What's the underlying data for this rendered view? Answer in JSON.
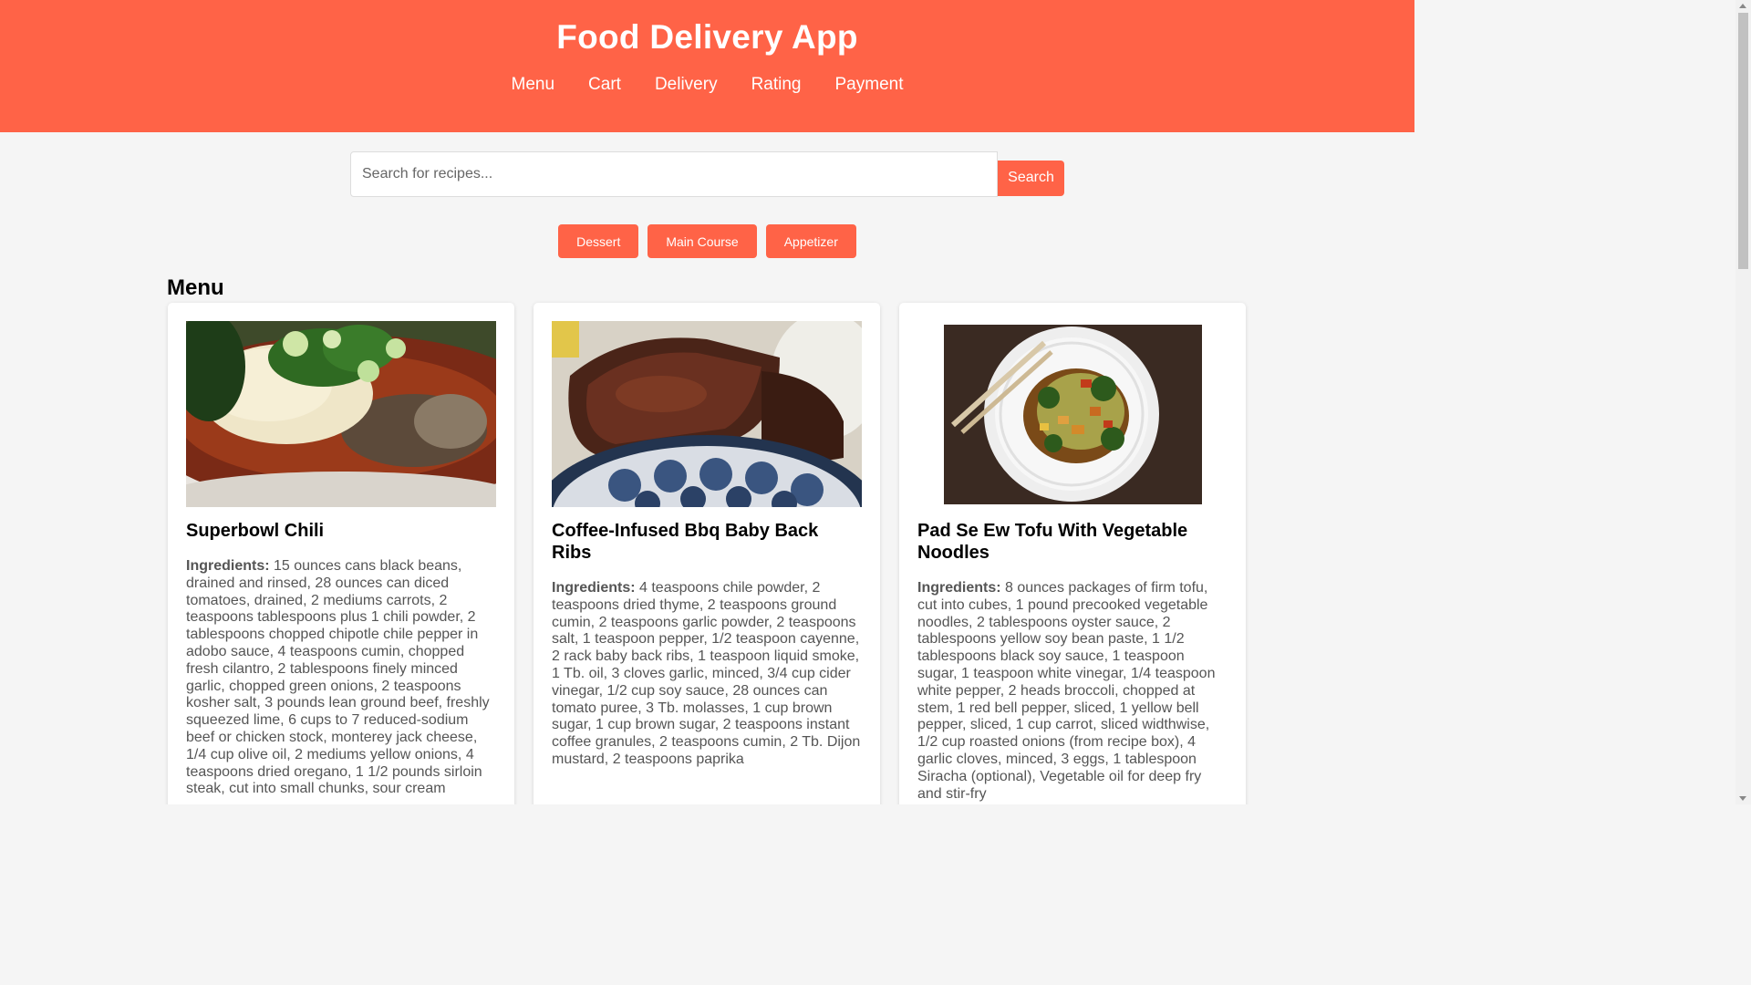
{
  "header": {
    "title": "Food Delivery App",
    "nav": [
      "Menu",
      "Cart",
      "Delivery",
      "Rating",
      "Payment"
    ]
  },
  "search": {
    "placeholder": "Search for recipes...",
    "button_label": "Search"
  },
  "categories": [
    "Dessert",
    "Main Course",
    "Appetizer"
  ],
  "menu": {
    "heading": "Menu",
    "items": [
      {
        "title": "Superbowl Chili",
        "ingredients_label": "Ingredients:",
        "ingredients": "15 ounces cans black beans, drained and rinsed, 28 ounces can diced tomatoes, drained, 2 mediums carrots, 2 teaspoons tablespoons plus 1 chili powder, 2 tablespoons chopped chipotle chile pepper in adobo sauce, 4 teaspoons cumin, chopped fresh cilantro, 2 tablespoons finely minced garlic, chopped green onions, 2 teaspoons kosher salt, 3 pounds lean ground beef, freshly squeezed lime, 6 cups to 7 reduced-sodium beef or chicken stock, monterey jack cheese, 1/4 cup olive oil, 2 mediums yellow onions, 4 teaspoons dried oregano, 1 1/2 pounds sirloin steak, cut into small chunks, sour cream"
      },
      {
        "title": "Coffee-Infused Bbq Baby Back Ribs",
        "ingredients_label": "Ingredients:",
        "ingredients": "4 teaspoons chile powder, 2 teaspoons dried thyme, 2 teaspoons ground cumin, 2 teaspoons garlic powder, 2 teaspoons salt, 1 teaspoon pepper, 1/2 teaspoon cayenne, 2 rack baby back ribs, 1 teaspoon liquid smoke, 1 Tb. oil, 3 cloves garlic, minced, 3/4 cup cider vinegar, 1/2 cup soy sauce, 28 ounces can tomato puree, 3 Tb. molasses, 1 cup brown sugar, 1 cup brown sugar, 2 teaspoons instant coffee granules, 2 teaspoons cumin, 2 Tb. Dijon mustard, 2 teaspoons paprika"
      },
      {
        "title": "Pad Se Ew Tofu With Vegetable Noodles",
        "ingredients_label": "Ingredients:",
        "ingredients": "8 ounces packages of firm tofu, cut into cubes, 1 pound precooked vegetable noodles, 2 tablespoons oyster sauce, 2 tablespoons yellow soy bean paste, 1 1/2 tablespoons black soy sauce, 1 teaspoon sugar, 1 teaspoon white vinegar, 1/4 teaspoon white pepper, 2 heads broccoli, chopped at stem, 1 red bell pepper, sliced, 1 yellow bell pepper, sliced, 1 cup carrot, sliced widthwise, 1/2 cup roasted onions (from recipe box), 4 garlic cloves, minced, 3 eggs, 1 tablespoon Siracha (optional), Vegetable oil for deep fry and stir-fry"
      }
    ]
  },
  "colors": {
    "accent": "#ff6347",
    "background": "#f5f5f5"
  }
}
